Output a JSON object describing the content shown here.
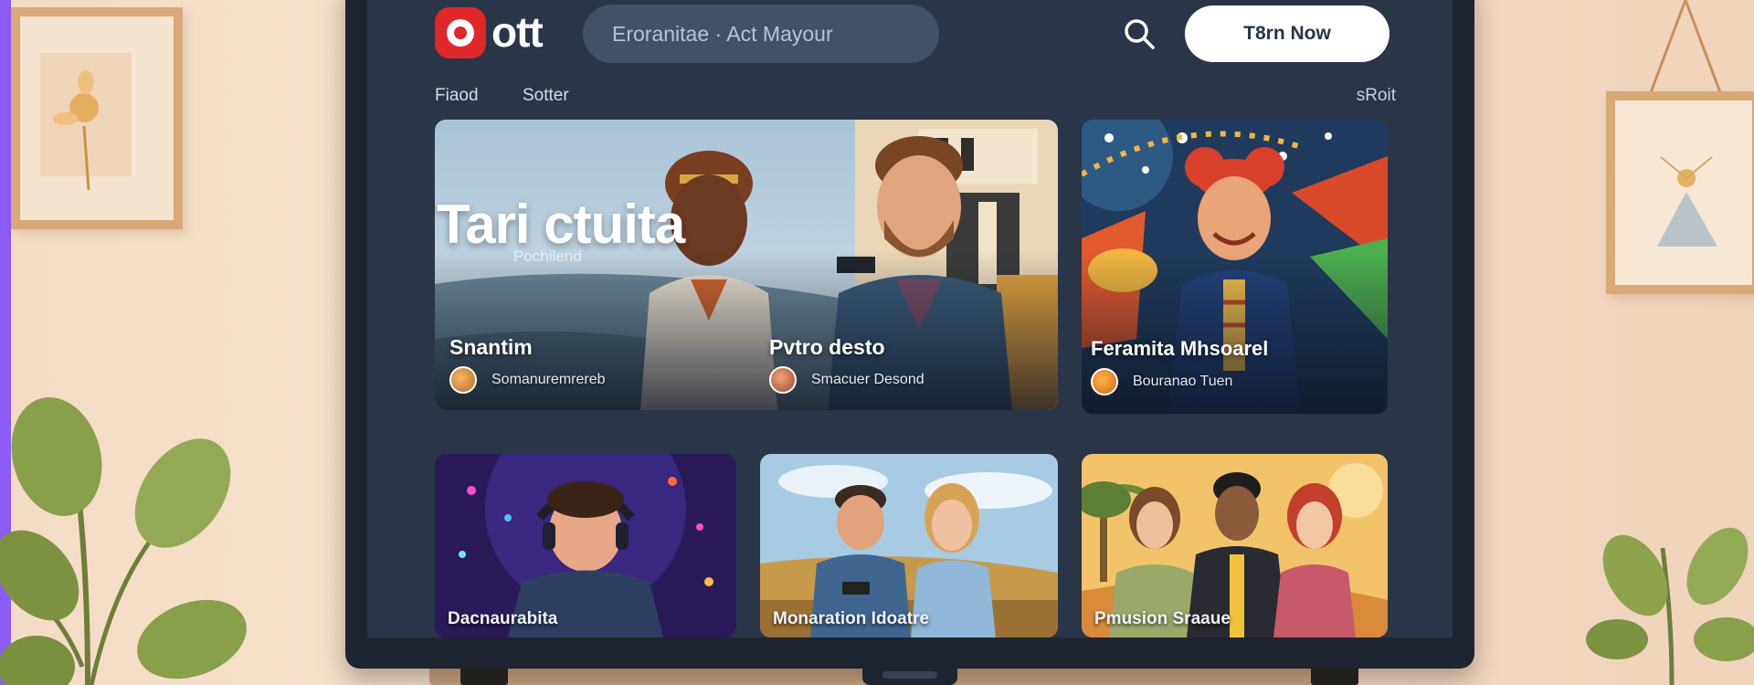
{
  "brand": {
    "name": "ott"
  },
  "search": {
    "text": "Eroranitae  ·  Act Mayour"
  },
  "header": {
    "cta_label": "T8rn Now"
  },
  "nav": {
    "items": [
      {
        "label": "Fiaod"
      },
      {
        "label": "Sotter"
      }
    ],
    "right_label": "sRoit"
  },
  "hero": {
    "title": "Tari ctuita",
    "subtitle": "Pochilend",
    "items": [
      {
        "title": "Snantim",
        "meta": "Somanuremrereb"
      },
      {
        "title": "Pvtro desto",
        "meta": "Smacuer Desond"
      }
    ]
  },
  "side_card": {
    "title": "Feramita Mhsoarel",
    "meta": "Bouranao Tuen"
  },
  "rows": [
    {
      "title": "Dacnaurabita"
    },
    {
      "title": "Monaration Idoatre"
    },
    {
      "title": "Pmusion Sraaue"
    }
  ],
  "colors": {
    "brand_red": "#e0282b",
    "screen_bg": "#2a3548",
    "accent_strip": "#8b5cf6"
  }
}
